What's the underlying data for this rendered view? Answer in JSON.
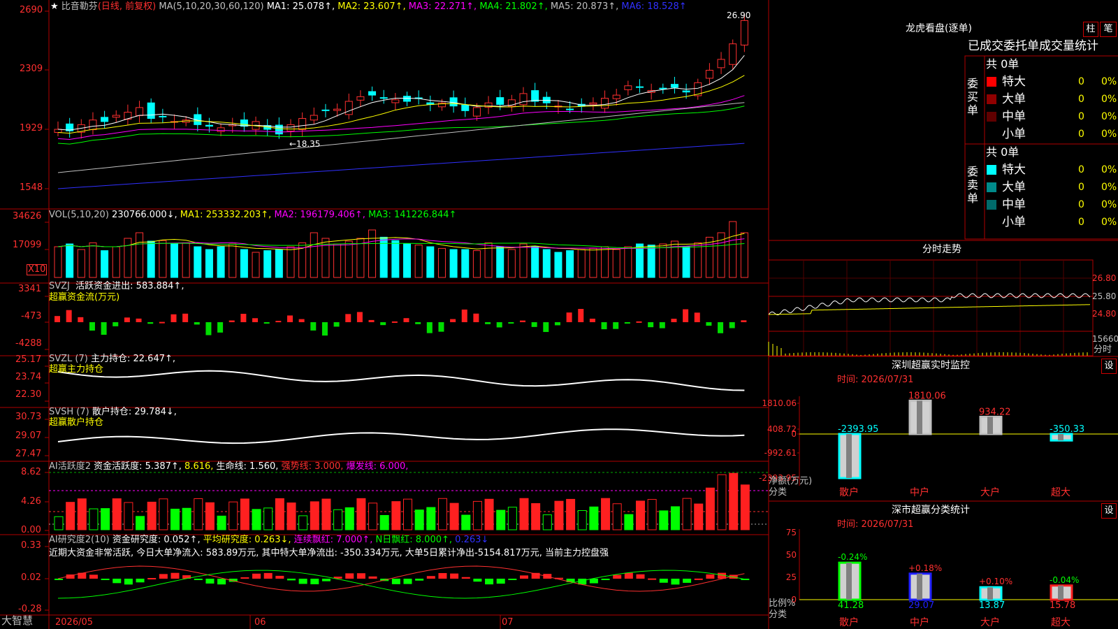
{
  "app": {
    "name": "大智慧"
  },
  "stock": {
    "header_prefix": "★",
    "name": "比音勒芬",
    "mode": "(日线, 前复权)",
    "ma_param": "MA(5,10,20,30,60,120)",
    "ma": [
      {
        "label": "MA1: 25.078↑,",
        "color": "#ffffff"
      },
      {
        "label": "MA2: 23.607↑,",
        "color": "#ffff00"
      },
      {
        "label": "MA3: 22.271↑,",
        "color": "#ff00ff"
      },
      {
        "label": "MA4: 21.802↑,",
        "color": "#00ff00"
      },
      {
        "label": "MA5: 20.873↑,",
        "color": "#c0c0c0"
      },
      {
        "label": "MA6: 18.528↑",
        "color": "#3030ff"
      }
    ],
    "high_label": "26.90",
    "low_label": "←18.35",
    "y_ticks": [
      "2690",
      "2309",
      "1929",
      "1548"
    ]
  },
  "vol": {
    "header": "VOL(5,10,20)",
    "value": "230766.000↓,",
    "ma1": "MA1: 253332.203↑,",
    "ma2": "MA2: 196179.406↑,",
    "ma3": "MA3: 141226.844↑",
    "y_ticks": [
      "34626",
      "17099"
    ],
    "unit": "X10"
  },
  "svzj": {
    "header": "SVZJ",
    "label": "活跃资金进出: 583.884↑,",
    "sub": "超赢资金流(万元)",
    "y_ticks": [
      "3341",
      "-473",
      "-4288"
    ]
  },
  "svzl": {
    "header": "SVZL (7)",
    "label": "主力持仓: 22.647↑,",
    "sub": "超赢主力持仓",
    "y_ticks": [
      "25.17",
      "23.74",
      "22.30"
    ]
  },
  "svsh": {
    "header": "SVSH (7)",
    "label": "散户持仓: 29.784↓,",
    "sub": "超赢散户持仓",
    "y_ticks": [
      "30.73",
      "29.07",
      "27.47"
    ]
  },
  "ai1": {
    "header": "AI活跃度2",
    "fund": "资金活跃度: 5.387↑,",
    "val2": "8.616,",
    "life": "生命线: 1.560,",
    "strong": "强势线: 3.000,",
    "burst": "爆发线: 6.000,",
    "y_ticks": [
      "8.62",
      "4.26",
      "0.00"
    ]
  },
  "ai2": {
    "header": "AI研究度2(10)",
    "fund": "资金研究度: 0.052↑,",
    "avg": "平均研究度: 0.263↓,",
    "cont": "连续飘红: 7.000↑,",
    "nday": "N日飘红: 8.000↑,",
    "last": "0.263↓",
    "summary": "近期大资金非常活跃, 今日大单净流入: 583.89万元, 其中特大单净流出: -350.334万元, 大单5日累计净出-5154.817万元, 当前主力控盘强",
    "y_ticks": [
      "0.33",
      "0.02",
      "-0.28"
    ]
  },
  "xaxis": {
    "labels": [
      "2026/05",
      "06",
      "07"
    ]
  },
  "right": {
    "lhb_title": "龙虎看盘(逐单)",
    "btn_zhu": "柱",
    "btn_bi": "笔",
    "stats_title": "已成交委托单成交量统计",
    "buy_label": "委买单",
    "sell_label": "委卖单",
    "buy_total": "共 0单",
    "sell_total": "共 0单",
    "buy_rows": [
      {
        "name": "特大",
        "color": "#ff0000",
        "num": "0",
        "pct": "0%"
      },
      {
        "name": "大单",
        "color": "#900000",
        "num": "0",
        "pct": "0%"
      },
      {
        "name": "中单",
        "color": "#600000",
        "num": "0",
        "pct": "0%"
      },
      {
        "name": "小单",
        "color": "",
        "num": "0",
        "pct": "0%"
      }
    ],
    "sell_rows": [
      {
        "name": "特大",
        "color": "#00ffff",
        "num": "0",
        "pct": "0%"
      },
      {
        "name": "大单",
        "color": "#008a8a",
        "num": "0",
        "pct": "0%"
      },
      {
        "name": "中单",
        "color": "#006a6a",
        "num": "0",
        "pct": "0%"
      },
      {
        "name": "小单",
        "color": "",
        "num": "0",
        "pct": "0%"
      }
    ],
    "fs_title": "分时走势",
    "fs_ticks": [
      "26.80",
      "25.80",
      "24.80",
      "15660"
    ],
    "fs_bottom": "分时",
    "sz_title": "深圳超赢实时监控",
    "sz_time": "时间: 2026/07/31",
    "sz_btn": "设",
    "sz_ticks": [
      "1810.06",
      "408.72",
      "0",
      "-992.61",
      "-2393.95"
    ],
    "sz_unit": "净额(万元)",
    "sz_cat": "分类",
    "sz_cats": [
      "散户",
      "中户",
      "大户",
      "超大"
    ],
    "sh_title": "深市超赢分类统计",
    "sh_time": "时间: 2026/07/31",
    "sh_btn": "设",
    "sh_ticks": [
      "75",
      "50",
      "25",
      "0"
    ],
    "sh_unit": "比例%",
    "sh_cat": "分类",
    "sh_cats": [
      "散户",
      "中户",
      "大户",
      "超大"
    ]
  },
  "chart_data": [
    {
      "type": "bar",
      "title": "深圳超赢实时监控",
      "categories": [
        "散户",
        "中户",
        "大户",
        "超大"
      ],
      "values": [
        -2393.95,
        1810.06,
        934.22,
        -350.33
      ],
      "labels": [
        "-2393.95",
        "1810.06",
        "934.22",
        "-350.33"
      ],
      "ylim": [
        -2393.95,
        1810.06
      ]
    },
    {
      "type": "bar",
      "title": "深市超赢分类统计",
      "categories": [
        "散户",
        "中户",
        "大户",
        "超大"
      ],
      "values": [
        41.28,
        29.07,
        13.87,
        15.78
      ],
      "labels": [
        "41.28",
        "29.07",
        "13.87",
        "15.78"
      ],
      "changes": [
        "-0.24%",
        "+0.18%",
        "+0.10%",
        "-0.04%"
      ],
      "colors": [
        "#00ff00",
        "#2020ff",
        "#00ffff",
        "#ff2020"
      ],
      "ylim": [
        0,
        75
      ]
    }
  ]
}
